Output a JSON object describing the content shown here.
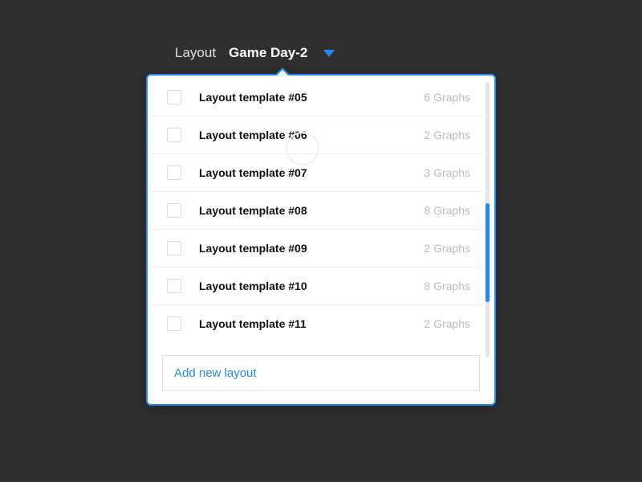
{
  "header": {
    "label": "Layout",
    "current": "Game Day-2"
  },
  "list": [
    {
      "name": "Layout template #05",
      "meta": "6 Graphs"
    },
    {
      "name": "Layout template #06",
      "meta": "2 Graphs"
    },
    {
      "name": "Layout template #07",
      "meta": "3 Graphs"
    },
    {
      "name": "Layout template #08",
      "meta": "8 Graphs"
    },
    {
      "name": "Layout template #09",
      "meta": "2 Graphs"
    },
    {
      "name": "Layout template #10",
      "meta": "8 Graphs"
    },
    {
      "name": "Layout template #11",
      "meta": "2 Graphs"
    }
  ],
  "add_layout_placeholder": "Add new layout"
}
